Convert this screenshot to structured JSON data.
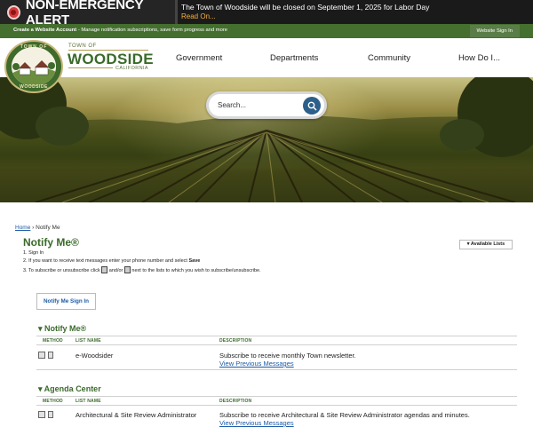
{
  "alert": {
    "title": "NON-EMERGENCY ALERT",
    "message": "The Town of Woodside will be closed on September 1, 2025 for Labor Day",
    "read_on": "Read On..."
  },
  "account_bar": {
    "create_label": "Create a Website Account",
    "create_desc": " - Manage notification subscriptions, save form progress and more",
    "signin_label": "Website Sign In"
  },
  "brand": {
    "seal_top": "TOWN OF",
    "seal_bottom": "WOODSIDE",
    "town_of": "TOWN OF",
    "name": "WOODSIDE",
    "state": "CALIFORNIA"
  },
  "nav": {
    "items": [
      "Government",
      "Departments",
      "Community",
      "How Do I..."
    ]
  },
  "search": {
    "placeholder": "Search..."
  },
  "breadcrumb": {
    "home": "Home",
    "separator": " › ",
    "current": "Notify Me"
  },
  "page": {
    "title": "Notify Me®",
    "available_lists": "▾  Available Lists",
    "step1": "1. Sign In",
    "step2_pre": "2. If you want to receive text messages enter your phone number and select ",
    "step2_bold": "Save",
    "step3_pre": "3. To subscribe or unsubscribe click ",
    "step3_mid": " and/or ",
    "step3_post": " next to the lists to which you wish to subscribe/unsubscribe.",
    "signin_button": "Notify Me Sign In"
  },
  "table_headers": {
    "method": "METHOD",
    "list_name": "LIST NAME",
    "description": "DESCRIPTION"
  },
  "sections": [
    {
      "title": "▾ Notify Me®",
      "rows": [
        {
          "name": "e-Woodsider",
          "description": "Subscribe to receive monthly Town newsletter.",
          "link": "View Previous Messages"
        }
      ]
    },
    {
      "title": "▾ Agenda Center",
      "rows": [
        {
          "name": "Architectural & Site Review Administrator",
          "description": "Subscribe to receive Architectural & Site Review Administrator agendas and minutes.",
          "link": "View Previous Messages"
        }
      ]
    }
  ],
  "colors": {
    "brand_green": "#3a6a2a",
    "account_bar": "#446f2e",
    "alert_red": "#d63a3a",
    "link_blue": "#1c5aa6",
    "read_on": "#f5b041"
  }
}
